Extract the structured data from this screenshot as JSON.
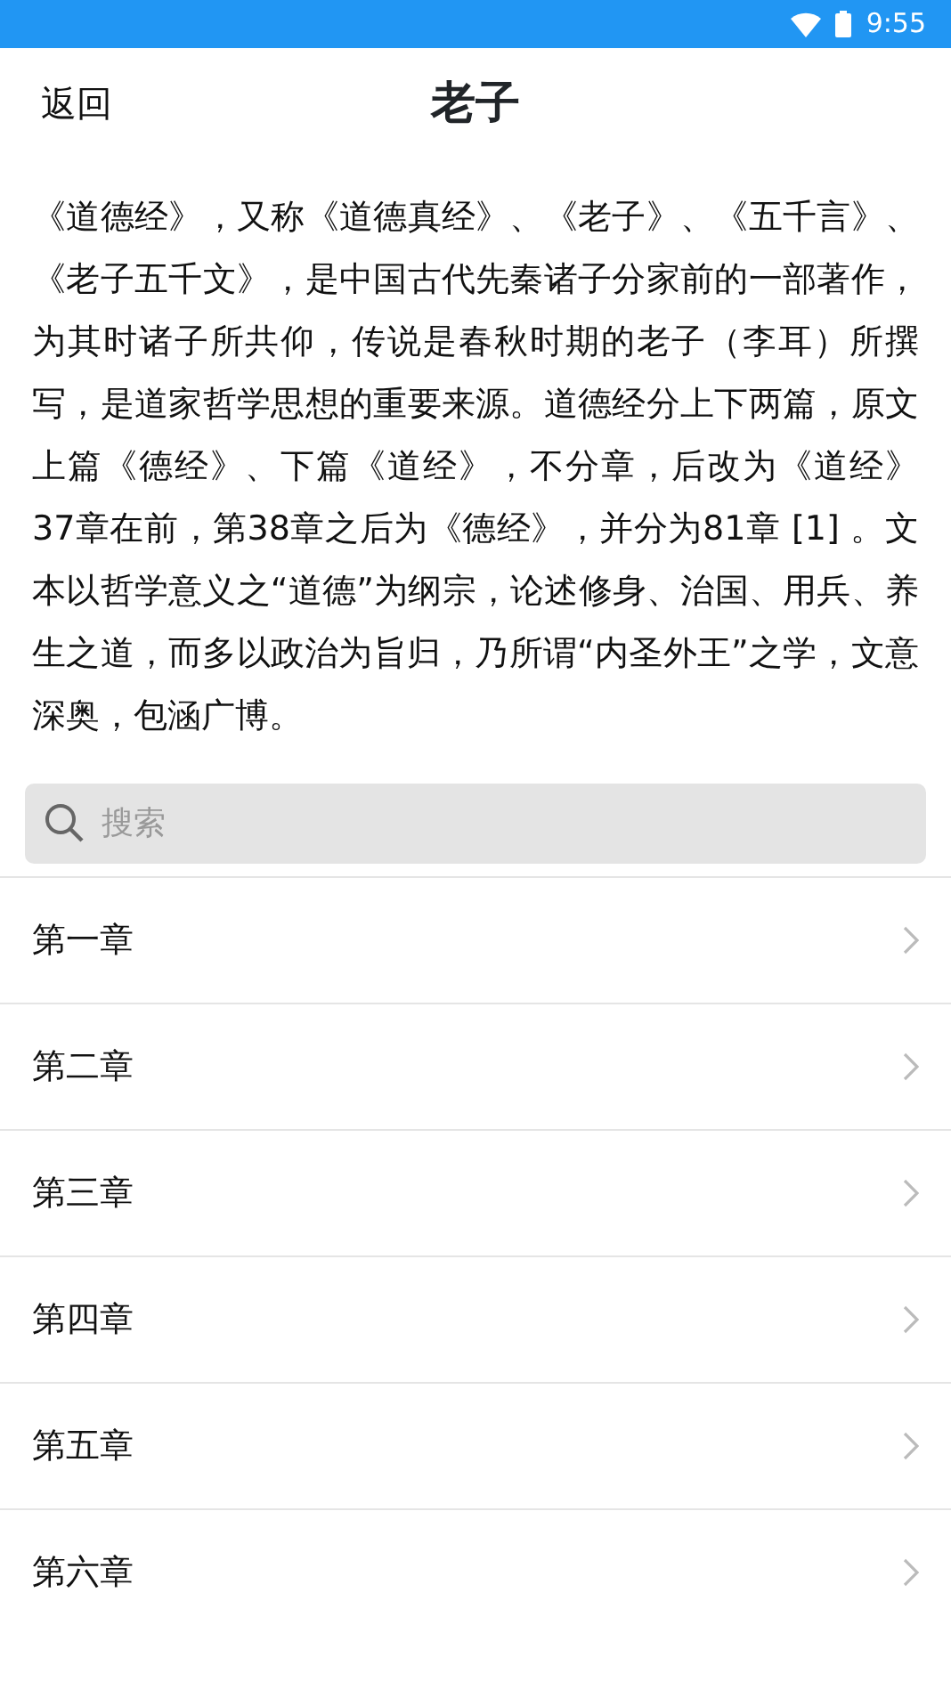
{
  "status_bar": {
    "time": "9:55"
  },
  "header": {
    "back": "返回",
    "title": "老子"
  },
  "intro": "《道德经》，又称《道德真经》、《老子》、《五千言》、《老子五千文》，是中国古代先秦诸子分家前的一部著作，为其时诸子所共仰，传说是春秋时期的老子（李耳）所撰写，是道家哲学思想的重要来源。道德经分上下两篇，原文上篇《德经》、下篇《道经》，不分章，后改为《道经》37章在前，第38章之后为《德经》，并分为81章 [1] 。文本以哲学意义之“道德”为纲宗，论述修身、治国、用兵、养生之道，而多以政治为旨归，乃所谓“内圣外王”之学，文意深奥，包涵广博。",
  "search": {
    "placeholder": "搜索"
  },
  "chapters": [
    {
      "label": "第一章"
    },
    {
      "label": "第二章"
    },
    {
      "label": "第三章"
    },
    {
      "label": "第四章"
    },
    {
      "label": "第五章"
    },
    {
      "label": "第六章"
    }
  ]
}
